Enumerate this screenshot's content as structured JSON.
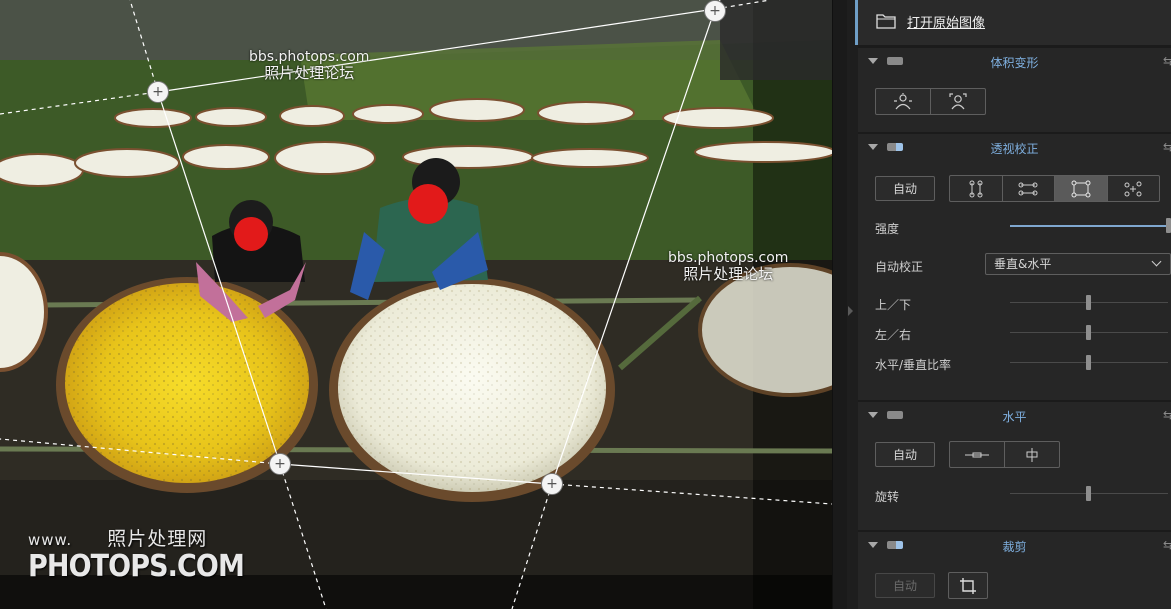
{
  "canvas": {
    "watermark_top_url": "bbs.photops.com",
    "watermark_top_cn": "照片处理论坛",
    "watermark_right_url": "bbs.photops.com",
    "watermark_right_cn": "照片处理论坛",
    "watermark_bottom_www": "www.",
    "watermark_bottom_cn": "照片处理网",
    "watermark_bottom_brand": "PHOTOPS.COM"
  },
  "panel": {
    "open_original": {
      "label": "打开原始图像",
      "icon": "folder-icon"
    },
    "sections": {
      "volume": {
        "title": "体积变形",
        "icons": [
          "person-center-icon",
          "person-portrait-icon"
        ],
        "reset_icon": "reset-icon"
      },
      "perspective": {
        "title": "透视校正",
        "auto_label": "自动",
        "modes": [
          "vertical-guides-icon",
          "horizontal-guides-icon",
          "rectangle-guides-icon",
          "free-points-icon"
        ],
        "active_mode": "rectangle-guides-icon",
        "strength_label": "强度",
        "strength_value": 1.0,
        "autocorrect_label": "自动校正",
        "autocorrect_value": "垂直&水平",
        "updown_label": "上／下",
        "updown_value": 0.5,
        "leftright_label": "左／右",
        "leftright_value": 0.5,
        "ratio_label": "水平/垂直比率",
        "ratio_value": 0.5
      },
      "level": {
        "title": "水平",
        "auto_label": "自动",
        "modes": [
          "horizontal-level-icon",
          "vertical-level-icon"
        ],
        "rotate_label": "旋转",
        "rotate_value": 0.5
      },
      "crop": {
        "title": "裁剪",
        "auto_label": "自动",
        "crop_icon": "crop-icon"
      }
    }
  },
  "colors": {
    "accent": "#7fb0e0",
    "panel_bg": "#262626"
  }
}
